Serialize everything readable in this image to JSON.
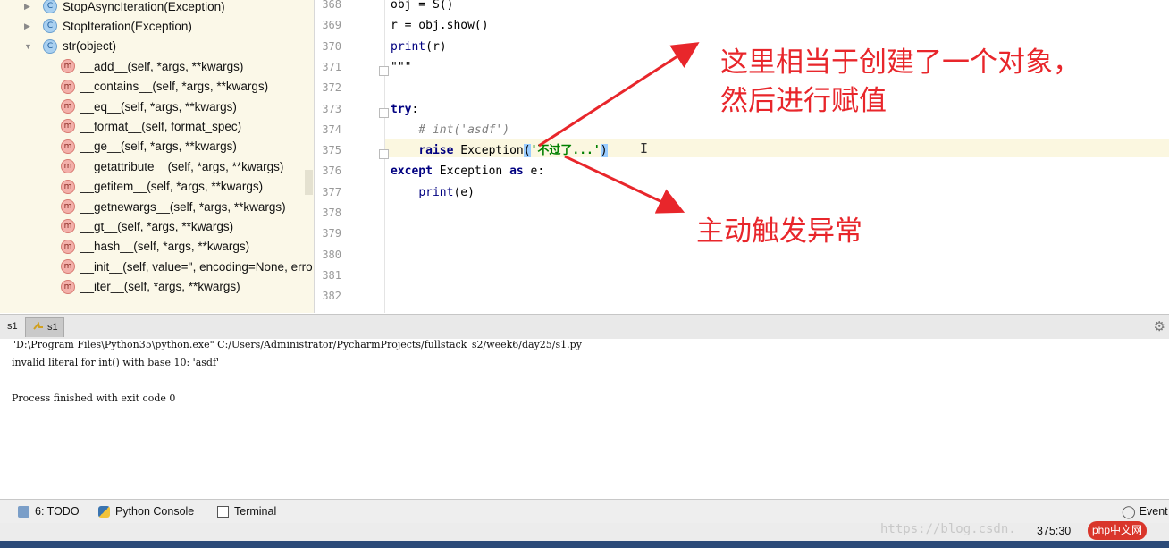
{
  "structure": {
    "items": [
      {
        "kind": "class",
        "arrow": "▶",
        "label": "StopAsyncIteration(Exception)"
      },
      {
        "kind": "class",
        "arrow": "▶",
        "label": "StopIteration(Exception)"
      },
      {
        "kind": "class",
        "arrow": "▼",
        "label": "str(object)"
      },
      {
        "kind": "method",
        "label": "__add__(self, *args, **kwargs)"
      },
      {
        "kind": "method",
        "label": "__contains__(self, *args, **kwargs)"
      },
      {
        "kind": "method",
        "label": "__eq__(self, *args, **kwargs)"
      },
      {
        "kind": "method",
        "label": "__format__(self, format_spec)"
      },
      {
        "kind": "method",
        "label": "__ge__(self, *args, **kwargs)"
      },
      {
        "kind": "method",
        "label": "__getattribute__(self, *args, **kwargs)"
      },
      {
        "kind": "method",
        "label": "__getitem__(self, *args, **kwargs)"
      },
      {
        "kind": "method",
        "label": "__getnewargs__(self, *args, **kwargs)"
      },
      {
        "kind": "method",
        "label": "__gt__(self, *args, **kwargs)"
      },
      {
        "kind": "method",
        "label": "__hash__(self, *args, **kwargs)"
      },
      {
        "kind": "method",
        "label": "__init__(self, value='', encoding=None, erro"
      },
      {
        "kind": "method",
        "label": "__iter__(self, *args, **kwargs)"
      }
    ],
    "badge_class": "C",
    "badge_method": "m"
  },
  "editor": {
    "lines": [
      {
        "no": "368",
        "code": "obj = S()"
      },
      {
        "no": "369",
        "code": "r = obj.show()"
      },
      {
        "no": "370",
        "code": "print(r)"
      },
      {
        "no": "371",
        "code": "\"\"\""
      },
      {
        "no": "372",
        "code": ""
      },
      {
        "no": "373",
        "code": "try:"
      },
      {
        "no": "374",
        "code": "    # int('asdf')"
      },
      {
        "no": "375",
        "code": "    raise Exception('不过了...')"
      },
      {
        "no": "376",
        "code": "except Exception as e:"
      },
      {
        "no": "377",
        "code": "    print(e)"
      },
      {
        "no": "378",
        "code": ""
      },
      {
        "no": "379",
        "code": ""
      },
      {
        "no": "380",
        "code": ""
      },
      {
        "no": "381",
        "code": ""
      },
      {
        "no": "382",
        "code": ""
      }
    ]
  },
  "annotations": {
    "top_line1": "这里相当于创建了一个对象，",
    "top_line2": "然后进行赋值",
    "bottom": "主动触发异常"
  },
  "run": {
    "tab_inactive": "s1",
    "tab_active": "s1",
    "console_lines": [
      "\"D:\\Program Files\\Python35\\python.exe\" C:/Users/Administrator/PycharmProjects/fullstack_s2/week6/day25/s1.py",
      "invalid literal for int() with base 10: 'asdf'",
      "",
      "Process finished with exit code 0"
    ]
  },
  "toolbar": {
    "todo": "6: TODO",
    "python_console": "Python Console",
    "terminal": "Terminal",
    "event": "Event"
  },
  "status": {
    "position": "375:30",
    "watermark": "https://blog.csdn.",
    "logo": "php中文网"
  },
  "colors": {
    "annotation": "#e8262b",
    "structure_bg": "#fbf8e8",
    "current_line": "#fbf7e0"
  }
}
